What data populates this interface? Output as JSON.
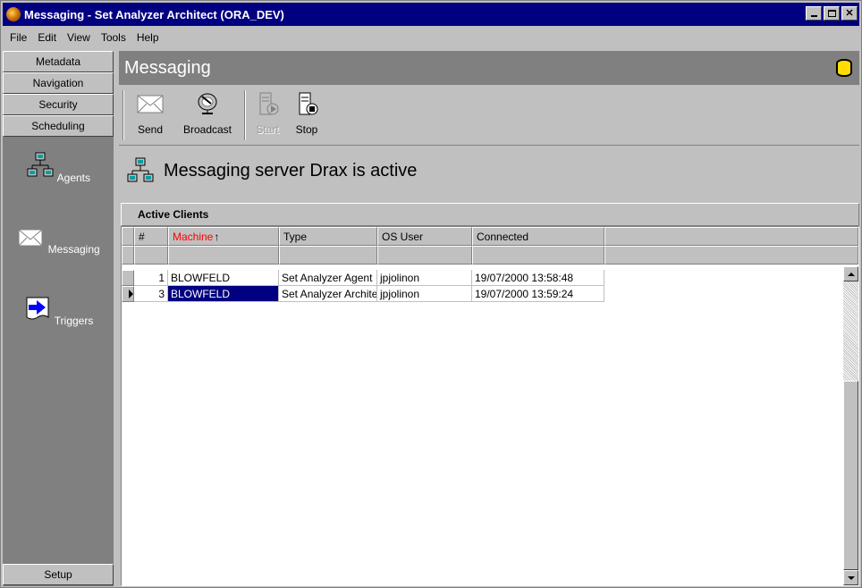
{
  "window": {
    "title": "Messaging - Set Analyzer Architect (ORA_DEV)"
  },
  "menu": {
    "items": [
      "File",
      "Edit",
      "View",
      "Tools",
      "Help"
    ]
  },
  "sidebar": {
    "top_buttons": [
      "Metadata",
      "Navigation",
      "Security",
      "Scheduling"
    ],
    "tools": [
      {
        "label": "Agents",
        "icon": "agents-network-icon"
      },
      {
        "label": "Messaging",
        "icon": "envelope-icon"
      },
      {
        "label": "Triggers",
        "icon": "arrow-document-icon"
      }
    ],
    "bottom_button": "Setup"
  },
  "main": {
    "header": "Messaging",
    "toolbar": [
      {
        "label": "Send",
        "icon": "envelope-icon",
        "enabled": true
      },
      {
        "label": "Broadcast",
        "icon": "satellite-dish-icon",
        "enabled": true
      },
      {
        "label": "Start",
        "icon": "server-start-icon",
        "enabled": false
      },
      {
        "label": "Stop",
        "icon": "server-stop-icon",
        "enabled": true
      }
    ],
    "status": "Messaging server Drax is active"
  },
  "grid": {
    "title": "Active Clients",
    "columns": [
      "#",
      "Machine",
      "Type",
      "OS User",
      "Connected"
    ],
    "sorted_column": "Machine",
    "rows": [
      {
        "num": "1",
        "machine": "BLOWFELD",
        "type": "Set Analyzer Agent",
        "os_user": "jpjolinon",
        "connected": "19/07/2000 13:58:48",
        "current": false
      },
      {
        "num": "3",
        "machine": "BLOWFELD",
        "type": "Set Analyzer Architect",
        "os_user": "jpjolinon",
        "connected": "19/07/2000 13:59:24",
        "current": true
      }
    ]
  }
}
